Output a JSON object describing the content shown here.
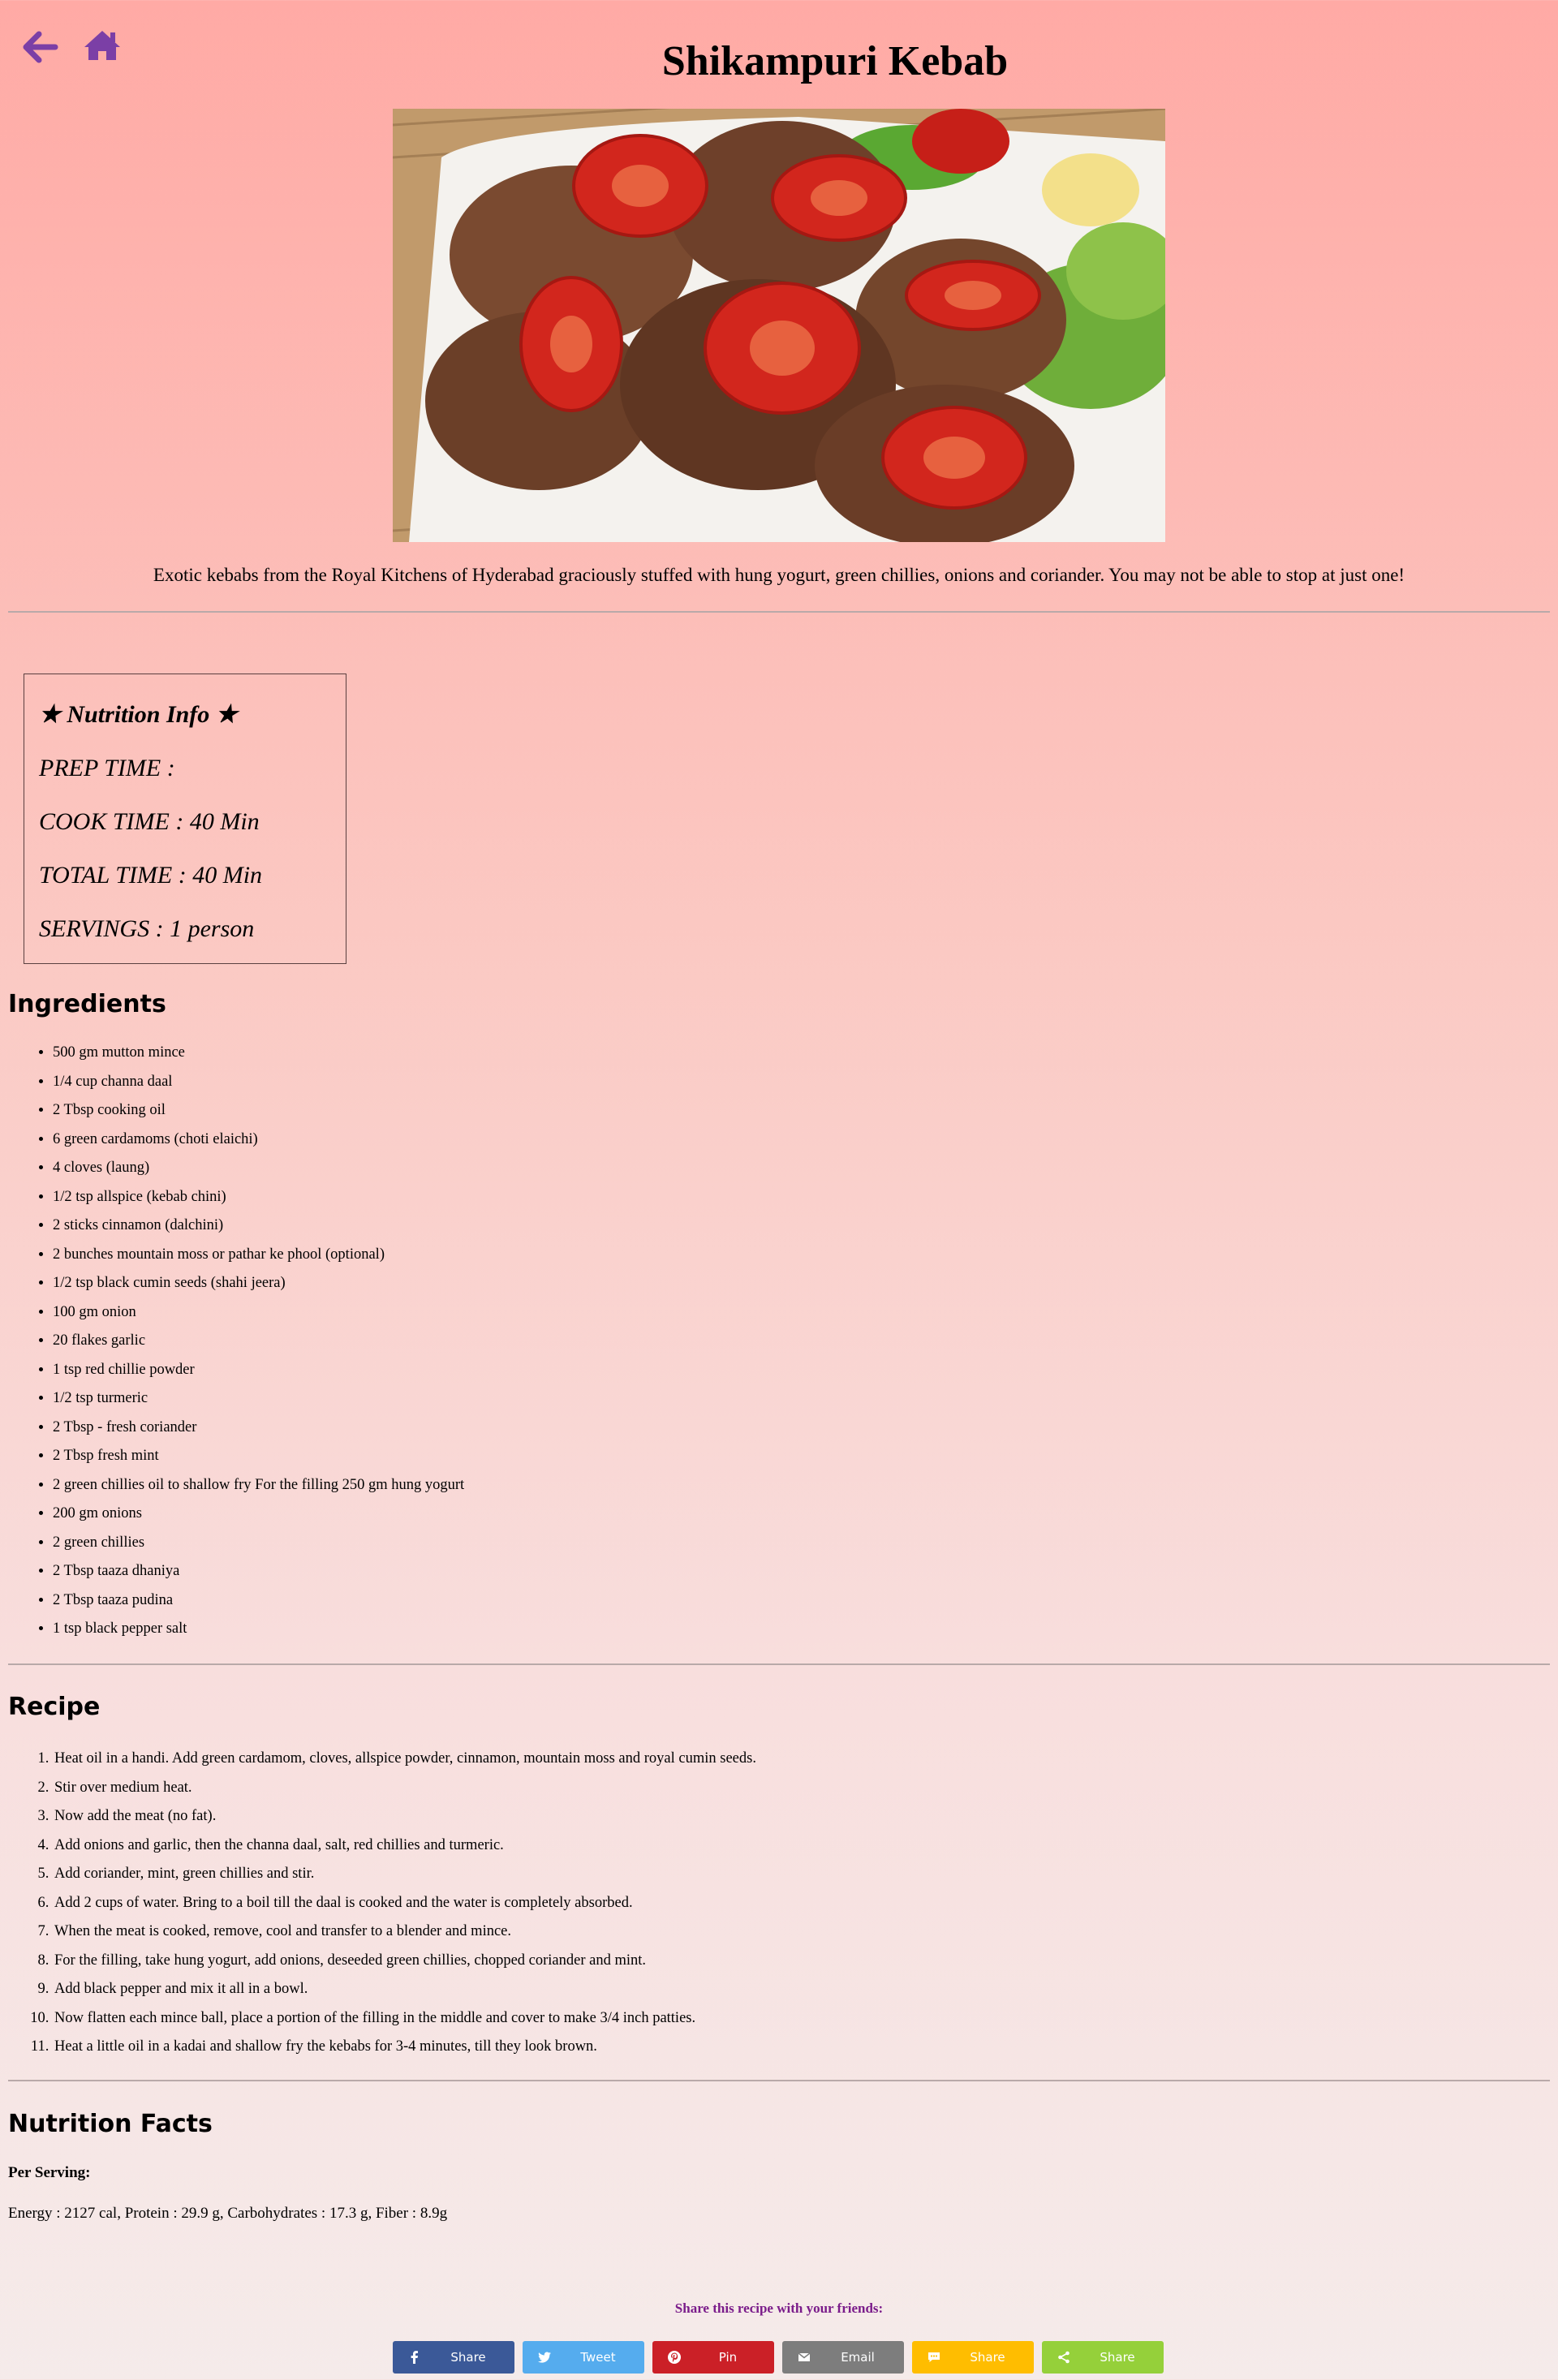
{
  "nav": {
    "back_icon": "arrow-left-icon",
    "home_icon": "home-icon",
    "icon_color": "#7b3fa6"
  },
  "title": "Shikampuri Kebab",
  "hero_image": {
    "alt": "Shikampuri Kebab"
  },
  "intro": "Exotic kebabs from the Royal Kitchens of Hyderabad graciously stuffed with hung yogurt, green chillies, onions and coriander. You may not be able to stop at just one!",
  "nutrition_info": {
    "title": "★ Nutrition Info ★",
    "prep_time": "PREP TIME :",
    "cook_time": "COOK TIME : 40 Min",
    "total_time": "TOTAL TIME : 40 Min",
    "servings": "SERVINGS : 1 person"
  },
  "ingredients": {
    "heading": "Ingredients",
    "items": [
      "500 gm mutton mince",
      "1/4 cup channa daal",
      "2 Tbsp cooking oil",
      "6 green cardamoms (choti elaichi)",
      "4 cloves (laung)",
      "1/2 tsp allspice (kebab chini)",
      "2 sticks cinnamon (dalchini)",
      "2 bunches mountain moss or pathar ke phool (optional)",
      "1/2 tsp black cumin seeds (shahi jeera)",
      "100 gm onion",
      "20 flakes garlic",
      "1 tsp red chillie powder",
      "1/2 tsp turmeric",
      "2 Tbsp - fresh coriander",
      "2 Tbsp fresh mint",
      "2 green chillies oil to shallow fry For the filling 250 gm hung yogurt",
      "200 gm onions",
      "2 green chillies",
      "2 Tbsp taaza dhaniya",
      "2 Tbsp taaza pudina",
      "1 tsp black pepper salt"
    ]
  },
  "recipe": {
    "heading": "Recipe",
    "steps": [
      "Heat oil in a handi. Add green cardamom, cloves, allspice powder, cinnamon, mountain moss and royal cumin seeds.",
      "Stir over medium heat.",
      "Now add the meat (no fat).",
      "Add onions and garlic, then the channa daal, salt, red chillies and turmeric.",
      "Add coriander, mint, green chillies and stir.",
      "Add 2 cups of water. Bring to a boil till the daal is cooked and the water is completely absorbed.",
      "When the meat is cooked, remove, cool and transfer to a blender and mince.",
      "For the filling, take hung yogurt, add onions, deseeded green chillies, chopped coriander and mint.",
      "Add black pepper and mix it all in a bowl.",
      "Now flatten each mince ball, place a portion of the filling in the middle and cover to make 3/4 inch patties.",
      "Heat a little oil in a kadai and shallow fry the kebabs for 3-4 minutes, till they look brown."
    ]
  },
  "nutrition_facts": {
    "heading": "Nutrition Facts",
    "per_serving": "Per Serving:",
    "values": "Energy : 2127 cal, Protein : 29.9 g, Carbohydrates : 17.3 g, Fiber : 8.9g"
  },
  "share": {
    "label": "Share this recipe with your friends:",
    "buttons": [
      {
        "label": "Share",
        "icon": "facebook-icon",
        "color": "#3b5998"
      },
      {
        "label": "Tweet",
        "icon": "twitter-icon",
        "color": "#55acee"
      },
      {
        "label": "Pin",
        "icon": "pinterest-icon",
        "color": "#cb2027"
      },
      {
        "label": "Email",
        "icon": "email-icon",
        "color": "#7d7d7d"
      },
      {
        "label": "Share",
        "icon": "sms-icon",
        "color": "#ffbd00"
      },
      {
        "label": "Share",
        "icon": "share-icon",
        "color": "#95d03a"
      }
    ]
  }
}
